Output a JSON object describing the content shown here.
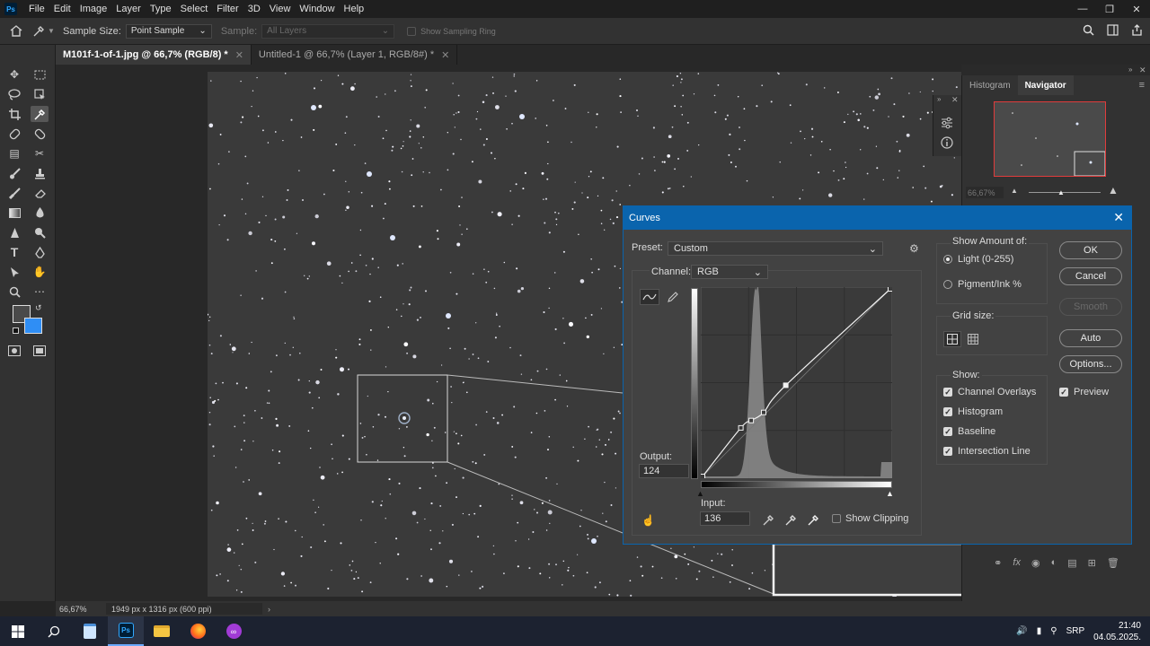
{
  "app": {
    "logo_text": "Ps"
  },
  "menu": [
    "File",
    "Edit",
    "Image",
    "Layer",
    "Type",
    "Select",
    "Filter",
    "3D",
    "View",
    "Window",
    "Help"
  ],
  "options_bar": {
    "sample_size_label": "Sample Size:",
    "sample_size_value": "Point Sample",
    "sample_label": "Sample:",
    "sample_value": "All Layers",
    "sampling_ring_label": "Show Sampling Ring"
  },
  "tabs": [
    {
      "label": "M101f-1-of-1.jpg @ 66,7% (RGB/8) *",
      "active": true
    },
    {
      "label": "Untitled-1 @ 66,7% (Layer 1, RGB/8#) *",
      "active": false
    }
  ],
  "navigator": {
    "tabs": [
      "Histogram",
      "Navigator"
    ],
    "zoom": "66,67%"
  },
  "curves": {
    "title": "Curves",
    "preset_label": "Preset:",
    "preset_value": "Custom",
    "channel_label": "Channel:",
    "channel_value": "RGB",
    "output_label": "Output:",
    "output_value": "124",
    "input_label": "Input:",
    "input_value": "136",
    "show_clipping_label": "Show Clipping",
    "show_amount_label": "Show Amount of:",
    "light_label": "Light  (0-255)",
    "pigment_label": "Pigment/Ink %",
    "grid_size_label": "Grid size:",
    "show_label": "Show:",
    "show_options": [
      "Channel Overlays",
      "Histogram",
      "Baseline",
      "Intersection Line"
    ],
    "buttons": {
      "ok": "OK",
      "cancel": "Cancel",
      "smooth": "Smooth",
      "auto": "Auto",
      "options": "Options..."
    },
    "preview_label": "Preview",
    "points": [
      [
        0,
        0
      ],
      [
        52,
        66
      ],
      [
        66,
        76
      ],
      [
        83,
        87
      ],
      [
        113,
        124
      ],
      [
        255,
        255
      ]
    ]
  },
  "status": {
    "zoom": "66,67%",
    "doc_info": "1949 px x 1316 px (600 ppi)"
  },
  "taskbar": {
    "language": "SRP",
    "time": "21:40",
    "date": "04.05.2025."
  }
}
